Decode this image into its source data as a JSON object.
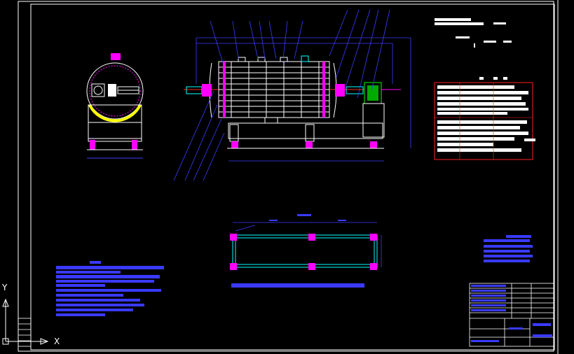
{
  "viewport": {
    "background": "#000000",
    "ucs": {
      "x_label": "X",
      "y_label": "Y"
    }
  },
  "colors": {
    "frame": "#ffffff",
    "drawing": "#ffffff",
    "dimension": "#3b3bff",
    "hatch": "#ffff00",
    "flange": "#ff00ff",
    "pipe": "#00ffff",
    "motor": "#00ff00",
    "table_border": "#ff2020",
    "notes_text": "#3a3aff"
  },
  "icons": [
    "ucs-icon"
  ]
}
